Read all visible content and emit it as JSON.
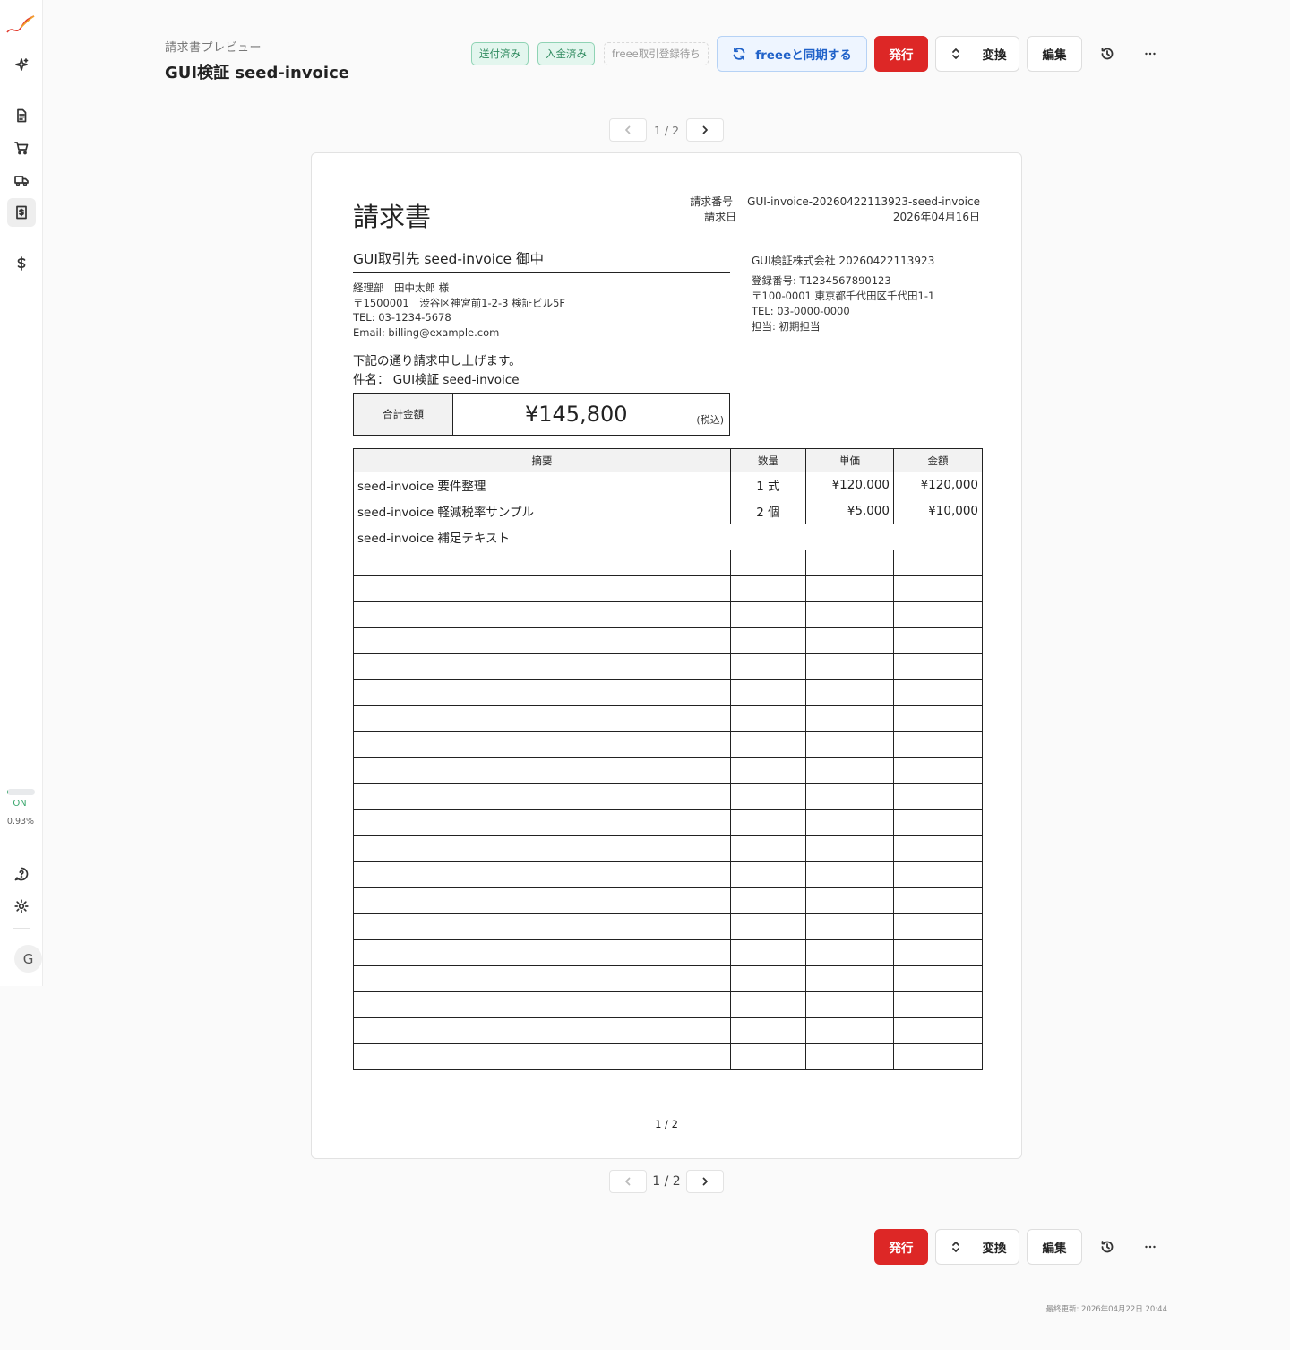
{
  "sidebar": {
    "usage_status": "ON",
    "usage_percent": "0.93%",
    "usage_fraction": 0.0093,
    "avatar_initial": "G"
  },
  "header": {
    "subtitle": "請求書プレビュー",
    "title": "GUI検証 seed-invoice"
  },
  "badges": {
    "sent": "送付済み",
    "paid": "入金済み",
    "freee_pending": "freee取引登録待ち"
  },
  "actions": {
    "sync": "freeeと同期する",
    "issue": "発行",
    "convert": "変換",
    "edit": "編集"
  },
  "pager": {
    "top_label": "1 / 2",
    "bottom_label": "1 / 2"
  },
  "invoice": {
    "title": "請求書",
    "number_label": "請求番号",
    "number": "GUI-invoice-20260422113923-seed-invoice",
    "date_label": "請求日",
    "date": "2026年04月16日",
    "client_name": "GUI取引先 seed-invoice 御中",
    "client_contact": "経理部　田中太郎 様",
    "client_address": "〒1500001　渋谷区神宮前1-2-3 検証ビル5F",
    "client_tel": "TEL: 03-1234-5678",
    "client_email": "Email: billing@example.com",
    "issuer_company": "GUI検証株式会社 20260422113923",
    "issuer_reg": "登録番号: T1234567890123",
    "issuer_address": "〒100-0001 東京都千代田区千代田1-1",
    "issuer_tel": "TEL: 03-0000-0000",
    "issuer_person": "担当: 初期担当",
    "intro": "下記の通り請求申し上げます。",
    "subject": "件名：  GUI検証 seed-invoice",
    "total_label": "合計金額",
    "total_amount": "¥145,800",
    "total_tax_note": "(税込)",
    "columns": {
      "desc": "摘要",
      "qty": "数量",
      "unit": "単価",
      "amount": "金額"
    },
    "items": [
      {
        "desc": "seed-invoice 要件整理",
        "qty": "1 式",
        "unit": "¥120,000",
        "amount": "¥120,000"
      },
      {
        "desc": "seed-invoice 軽減税率サンプル",
        "qty": "2 個",
        "unit": "¥5,000",
        "amount": "¥10,000"
      }
    ],
    "note_row": "seed-invoice 補足テキスト",
    "page_number": "1 / 2"
  },
  "footer": {
    "last_updated": "最終更新: 2026年04月22日 20:44"
  }
}
